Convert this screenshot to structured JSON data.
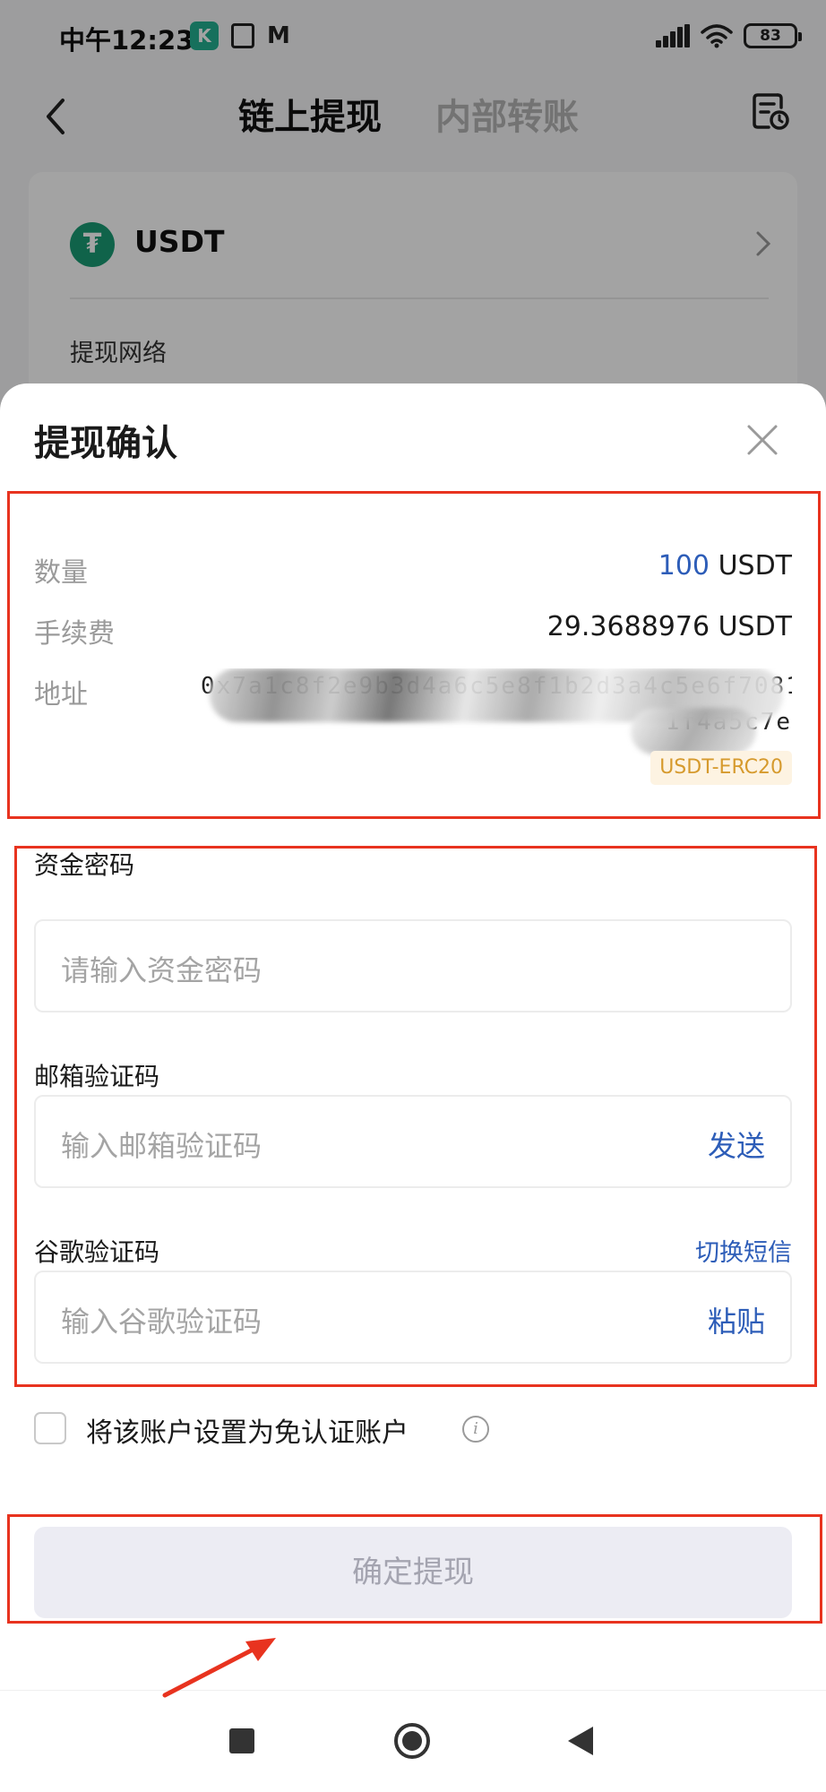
{
  "status_bar": {
    "time": "中午12:23",
    "kc_icon_text": "K",
    "battery": "83"
  },
  "nav": {
    "tab_active": "链上提现",
    "tab_inactive": "内部转账"
  },
  "background_card": {
    "coin_name": "USDT",
    "coin_symbol": "₮",
    "network_label": "提现网络"
  },
  "sheet": {
    "title": "提现确认",
    "amount": {
      "label": "数量",
      "number": "100",
      "unit": "USDT"
    },
    "fee": {
      "label": "手续费",
      "value": "29.3688976 USDT"
    },
    "address": {
      "label": "地址",
      "line1": "0x7a1c8f2e9b3d4a6c5e8f1b2d3a4c5e6f7081",
      "line2": "1f4a5c7e",
      "network_badge": "USDT-ERC20"
    },
    "fund_password": {
      "label": "资金密码",
      "placeholder": "请输入资金密码"
    },
    "email_code": {
      "label": "邮箱验证码",
      "placeholder": "输入邮箱验证码",
      "action": "发送"
    },
    "google_code": {
      "label": "谷歌验证码",
      "switch_link": "切换短信",
      "placeholder": "输入谷歌验证码",
      "action": "粘贴"
    },
    "trusted_account": {
      "label": "将该账户设置为免认证账户",
      "checked": false
    },
    "confirm_button": "确定提现"
  },
  "colors": {
    "accent_blue": "#2d5db8",
    "annotation_red": "#e8331f",
    "badge_orange": "#d69a2d",
    "tether_green": "#1a9b74"
  }
}
